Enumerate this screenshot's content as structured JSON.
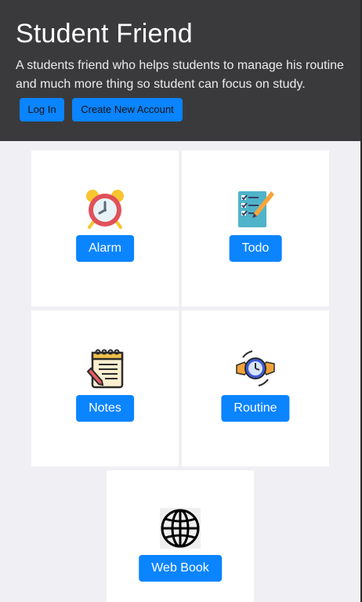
{
  "header": {
    "title": "Student Friend",
    "description": "A students friend who helps students to manage his routine and much more thing so student can focus on study.",
    "login_label": "Log In",
    "create_account_label": "Create New Account"
  },
  "cards": {
    "alarm": {
      "label": "Alarm",
      "icon": "alarm-clock-icon"
    },
    "todo": {
      "label": "Todo",
      "icon": "checklist-icon"
    },
    "notes": {
      "label": "Notes",
      "icon": "notepad-icon"
    },
    "routine": {
      "label": "Routine",
      "icon": "clock-hands-icon"
    },
    "webbook": {
      "label": "Web Book",
      "icon": "globe-icon"
    }
  },
  "colors": {
    "header_bg": "#3a3a3c",
    "accent": "#0a84ff",
    "page_bg": "#f0f0f4"
  }
}
